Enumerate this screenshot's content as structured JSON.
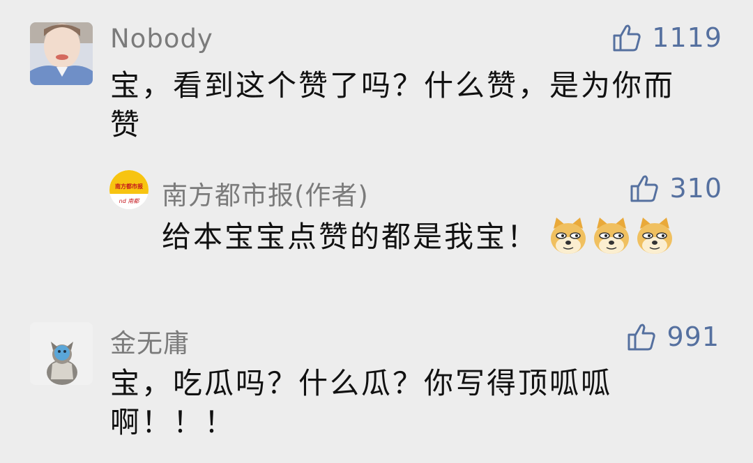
{
  "comments": [
    {
      "name": "Nobody",
      "likes": "1119",
      "text_line1": "宝，看到这个赞了吗？什么赞，是为你而",
      "text_line2": "赞",
      "reply": {
        "name": "南方都市报(作者)",
        "likes": "310",
        "text": "给本宝宝点赞的都是我宝！",
        "avatar_sign": "南方都市报",
        "avatar_logo": "nd 南都"
      }
    },
    {
      "name": "金无庸",
      "likes": "991",
      "text_line1": "宝，吃瓜吗？什么瓜？你写得顶呱呱",
      "text_line2": "啊！！！"
    }
  ],
  "colors": {
    "like_blue": "#55709f",
    "background": "#ededed",
    "name_gray": "#7b7b7b"
  },
  "icons": [
    "thumbs-up-icon",
    "doge-emoji-icon"
  ]
}
